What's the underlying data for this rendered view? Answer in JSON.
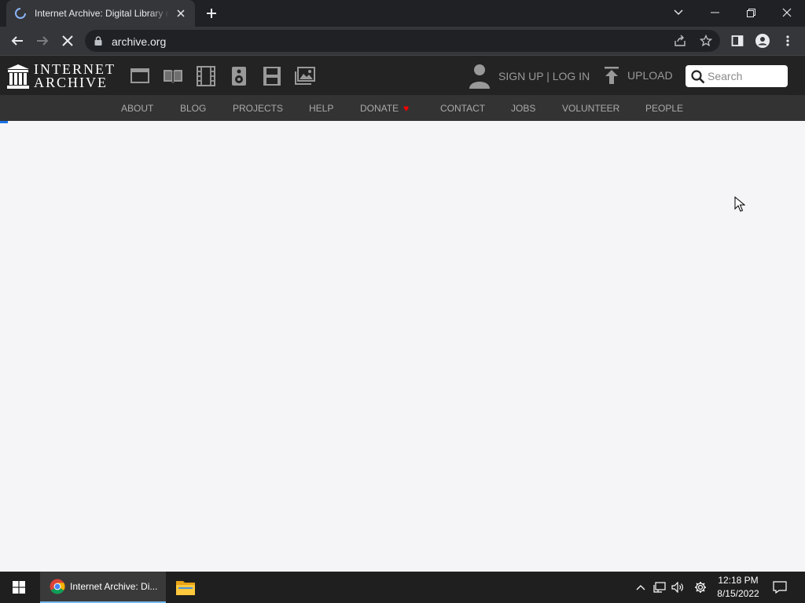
{
  "browser": {
    "tab": {
      "title": "Internet Archive: Digital Library of Free & Borrowable Books, Movies, Music & Wayback Machine",
      "loading": true
    },
    "new_tab_icon": "plus-icon",
    "window_controls": [
      "chevron-down-icon",
      "minimize-icon",
      "restore-icon",
      "close-icon"
    ],
    "toolbar": {
      "url": "archive.org",
      "buttons": [
        "back-icon",
        "forward-icon",
        "stop-icon"
      ],
      "right_buttons": [
        "share-icon",
        "star-icon",
        "side-panel-icon",
        "profile-icon",
        "menu-icon"
      ]
    },
    "accent_color": "#1a73e8"
  },
  "site": {
    "logo": {
      "line1": "INTERNET",
      "line2": "ARCHIVE"
    },
    "media_icons": [
      "web-icon",
      "texts-icon",
      "video-icon",
      "audio-icon",
      "software-icon",
      "images-icon"
    ],
    "account": {
      "label": "SIGN UP | LOG IN"
    },
    "upload": {
      "label": "UPLOAD"
    },
    "search": {
      "placeholder": "Search"
    },
    "nav": {
      "about": "ABOUT",
      "blog": "BLOG",
      "projects": "PROJECTS",
      "help": "HELP",
      "donate": "DONATE",
      "donate_heart": "♥",
      "contact": "CONTACT",
      "jobs": "JOBS",
      "volunteer": "VOLUNTEER",
      "people": "PEOPLE"
    },
    "heart_color": "#ff0000"
  },
  "taskbar": {
    "chrome_label": "Internet Archive: Di...",
    "tray_icons": [
      "chevron-up-icon",
      "network-icon",
      "volume-icon",
      "settings-icon"
    ],
    "time": "12:18 PM",
    "date": "8/15/2022"
  }
}
